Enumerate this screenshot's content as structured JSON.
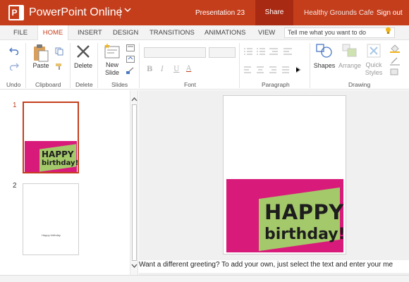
{
  "titlebar": {
    "app_name": "PowerPoint Online",
    "document_title": "Presentation 23",
    "share_label": "Share",
    "user_name": "Healthy Grounds Cafe",
    "sign_out_label": "Sign out",
    "accent_color": "#c43e1c"
  },
  "tabs": [
    {
      "label": "FILE"
    },
    {
      "label": "HOME",
      "active": true
    },
    {
      "label": "INSERT"
    },
    {
      "label": "DESIGN"
    },
    {
      "label": "TRANSITIONS"
    },
    {
      "label": "ANIMATIONS"
    },
    {
      "label": "VIEW"
    }
  ],
  "tell_me_placeholder": "Tell me what you want to do",
  "ribbon": {
    "groups": {
      "undo": "Undo",
      "clipboard": "Clipboard",
      "delete": "Delete",
      "slides": "Slides",
      "font": "Font",
      "paragraph": "Paragraph",
      "drawing": "Drawing"
    },
    "buttons": {
      "paste": "Paste",
      "delete": "Delete",
      "new_slide_line1": "New",
      "new_slide_line2": "Slide",
      "shapes": "Shapes",
      "arrange": "Arrange",
      "quick_styles_line1": "Quick",
      "quick_styles_line2": "Styles"
    },
    "font_buttons": {
      "bold": "B",
      "italic": "I",
      "underline": "U",
      "font_color": "A"
    }
  },
  "slides": [
    {
      "number": "1",
      "selected": true,
      "card_line1": "HAPPY",
      "card_line2": "birthday!"
    },
    {
      "number": "2",
      "selected": false,
      "text": "Happy birthday"
    }
  ],
  "main_slide": {
    "card_line1": "HAPPY",
    "card_line2": "birthday!",
    "card_colors": {
      "pink": "#d81b7a",
      "green": "#a4c96a"
    }
  },
  "notes_text": "Want a different greeting? To add your own, just select the text and enter your me"
}
